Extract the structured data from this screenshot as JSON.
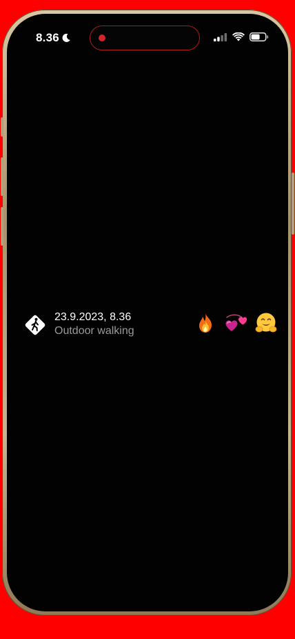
{
  "status_bar": {
    "time": "8.36",
    "focus_icon": "moon-icon",
    "signal_icon": "cellular-signal-icon",
    "wifi_icon": "wifi-icon",
    "battery_icon": "battery-icon",
    "recording_indicator_color": "#d0262a"
  },
  "activity": {
    "icon": "walking-figure-icon",
    "date": "23.9.2023, 8.36",
    "type": "Outdoor walking"
  },
  "reactions": [
    {
      "emoji": "🔥",
      "icon": "fire-icon"
    },
    {
      "emoji": "💞",
      "icon": "revolving-hearts-icon"
    },
    {
      "emoji": "🤗",
      "icon": "hugging-face-icon"
    }
  ],
  "colors": {
    "background": "#ff0000",
    "screen": "#020202",
    "primary_text": "#ffffff",
    "secondary_text": "#9a9a9a"
  }
}
